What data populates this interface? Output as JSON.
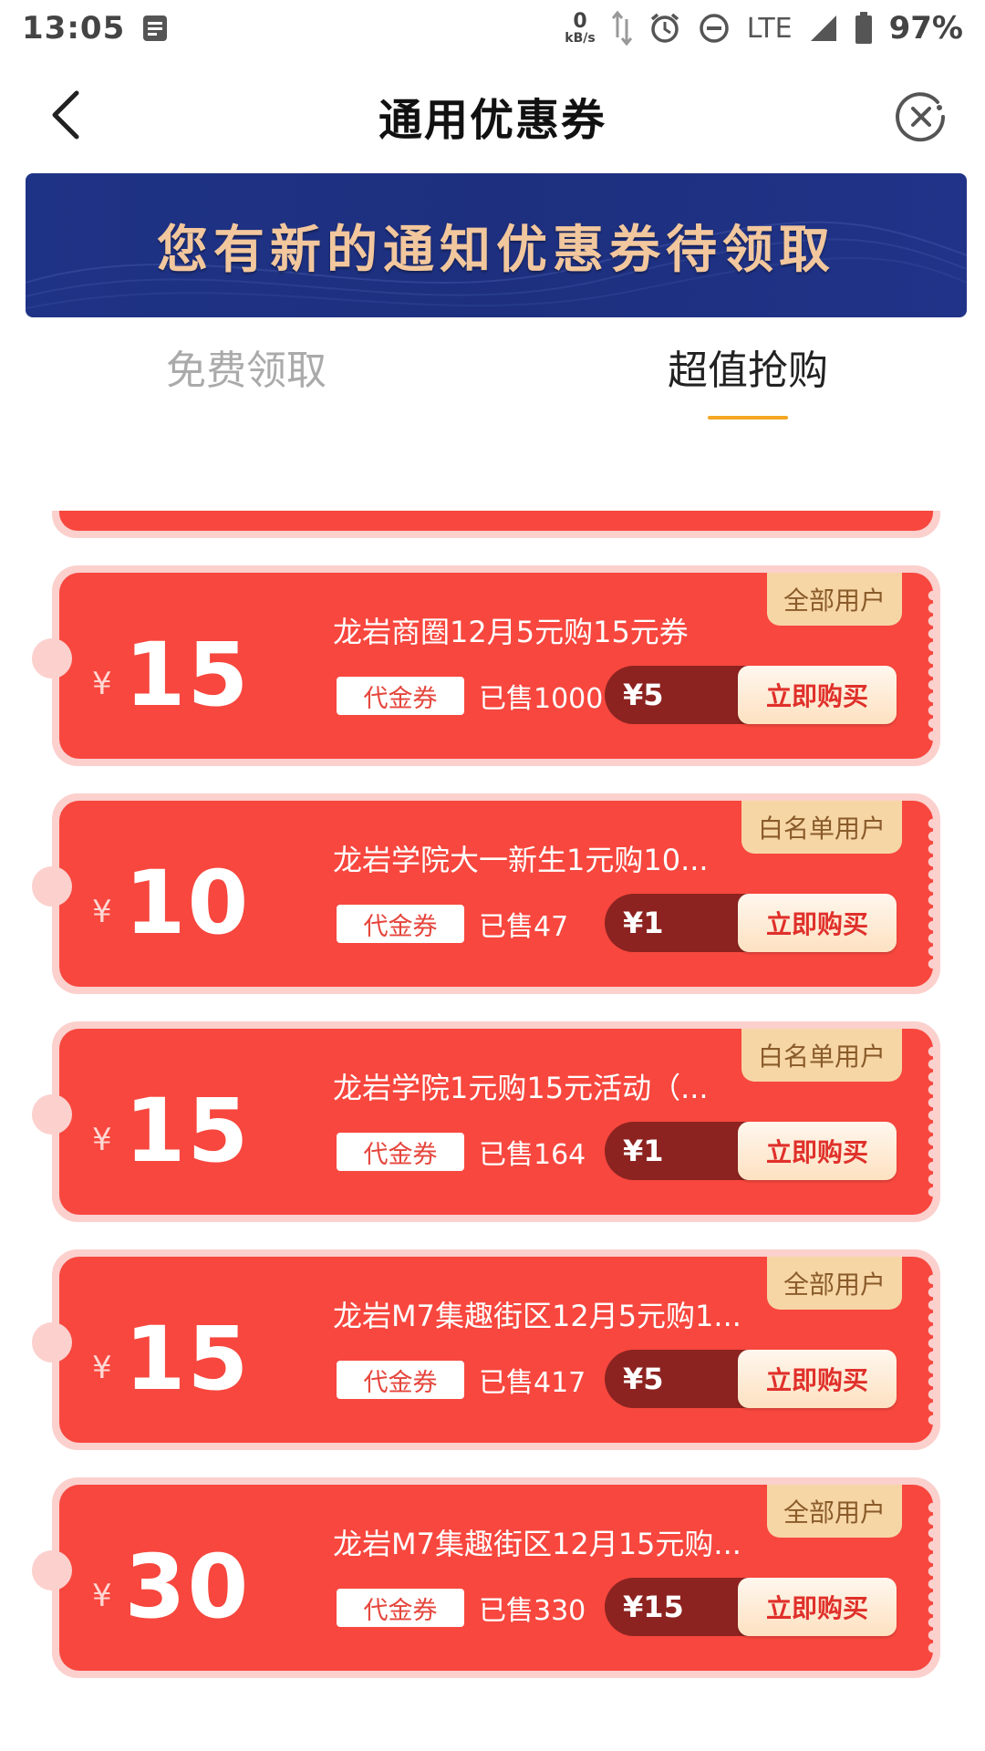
{
  "status_bar": {
    "time": "13:05",
    "net_speed_value": "0",
    "net_speed_unit": "kB/s",
    "network": "LTE",
    "battery": "97%"
  },
  "header": {
    "title": "通用优惠券"
  },
  "banner": {
    "text": "您有新的通知优惠券待领取"
  },
  "tabs": [
    {
      "label": "免费领取",
      "active": false
    },
    {
      "label": "超值抢购",
      "active": true
    }
  ],
  "colors": {
    "coupon_red": "#f7473e",
    "coupon_border": "#fbd0cd",
    "tab_accent": "#f5a623",
    "banner_blue": "#1f3386",
    "banner_text": "#f2c79d",
    "price_pill": "#8c2320",
    "tag_bg": "#f7d6a6"
  },
  "coupons": [
    {
      "tag": "全部用户",
      "currency": "¥",
      "amount": "15",
      "title": "龙岩商圈12月5元购15元券",
      "type": "代金券",
      "sold": "已售1000",
      "price": "¥5",
      "button": "立即购买"
    },
    {
      "tag": "白名单用户",
      "currency": "¥",
      "amount": "10",
      "title": "龙岩学院大一新生1元购10...",
      "type": "代金券",
      "sold": "已售47",
      "price": "¥1",
      "button": "立即购买"
    },
    {
      "tag": "白名单用户",
      "currency": "¥",
      "amount": "15",
      "title": "龙岩学院1元购15元活动（...",
      "type": "代金券",
      "sold": "已售164",
      "price": "¥1",
      "button": "立即购买"
    },
    {
      "tag": "全部用户",
      "currency": "¥",
      "amount": "15",
      "title": "龙岩M7集趣街区12月5元购1...",
      "type": "代金券",
      "sold": "已售417",
      "price": "¥5",
      "button": "立即购买"
    },
    {
      "tag": "全部用户",
      "currency": "¥",
      "amount": "30",
      "title": "龙岩M7集趣街区12月15元购...",
      "type": "代金券",
      "sold": "已售330",
      "price": "¥15",
      "button": "立即购买"
    }
  ]
}
